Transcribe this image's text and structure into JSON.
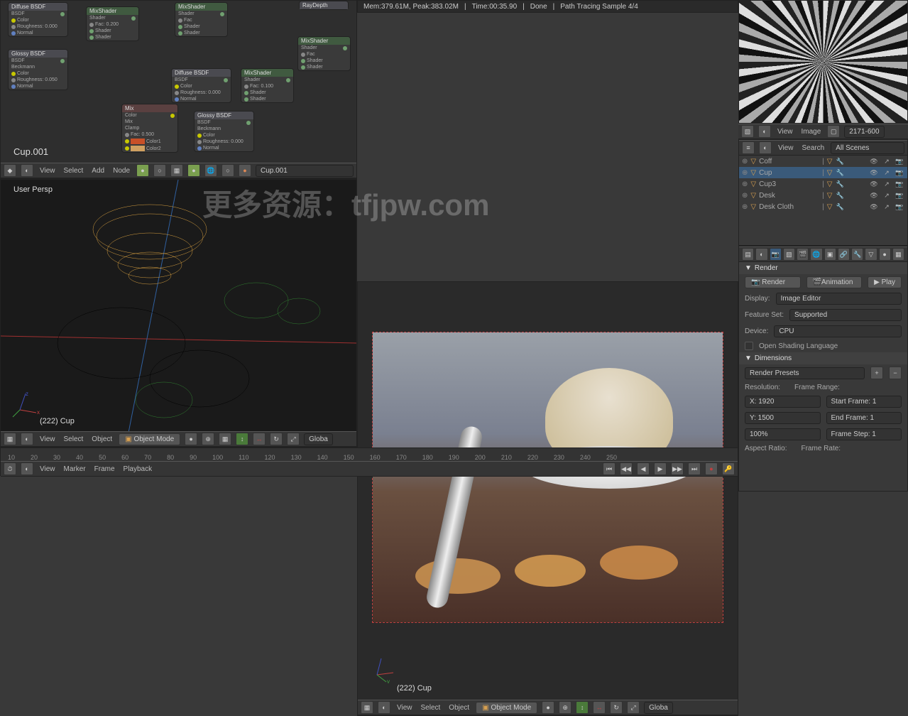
{
  "status_bar": {
    "mem": "Mem:379.61M, Peak:383.02M",
    "time": "Time:00:35.90",
    "done": "Done",
    "pathtrace": "Path Tracing Sample 4/4"
  },
  "node_editor": {
    "material": "Cup.001",
    "menu": {
      "view": "View",
      "select": "Select",
      "add": "Add",
      "node": "Node"
    },
    "nodes": {
      "diffuse1": {
        "title": "Diffuse BSDF",
        "rows": [
          "BSDF",
          "Color",
          "Roughness: 0.000",
          "Normal"
        ]
      },
      "glossy1": {
        "title": "Glossy BSDF",
        "rows": [
          "BSDF",
          "Beckmann",
          "Color",
          "Roughness: 0.050",
          "Normal"
        ]
      },
      "mix1": {
        "title": "Mix",
        "rows": [
          "Color",
          "Mix",
          "Clamp",
          "Fac: 0.500",
          "Color1",
          "Color2"
        ]
      },
      "mixshader1": {
        "title": "MixShader",
        "rows": [
          "Shader",
          "Fac: 0.200",
          "Shader",
          "Shader"
        ]
      },
      "diffuse2": {
        "title": "Diffuse BSDF",
        "rows": [
          "BSDF",
          "Color",
          "Roughness: 0.000",
          "Normal"
        ]
      },
      "glossy2": {
        "title": "Glossy BSDF",
        "rows": [
          "BSDF",
          "Beckmann",
          "Color",
          "Roughness: 0.000",
          "Normal"
        ]
      },
      "mixshader2": {
        "title": "MixShader",
        "rows": [
          "Shader",
          "Fac: 0.100",
          "Shader",
          "Shader"
        ]
      },
      "mixshader3": {
        "title": "MixShader",
        "rows": [
          "Shader",
          "Fac",
          "Shader",
          "Shader"
        ]
      },
      "raydepth": {
        "title": "RayDepth"
      }
    }
  },
  "viewport3d": {
    "label": "User Persp",
    "object": "(222) Cup",
    "menu": {
      "view": "View",
      "select": "Select",
      "object": "Object"
    },
    "mode": "Object Mode",
    "global": "Globa"
  },
  "render_view": {
    "object": "(222) Cup"
  },
  "image_editor": {
    "menu": {
      "view": "View",
      "image": "Image"
    },
    "name": "2171-600"
  },
  "outliner": {
    "menu": {
      "view": "View",
      "search": "Search"
    },
    "scenes": "All Scenes",
    "items": [
      {
        "name": "Coff"
      },
      {
        "name": "Cup"
      },
      {
        "name": "Cup3"
      },
      {
        "name": "Desk"
      },
      {
        "name": "Desk Cloth"
      }
    ]
  },
  "properties": {
    "render_hdr": "Render",
    "render_btn": "Render",
    "animation_btn": "Animation",
    "play_btn": "Play",
    "display": "Display:",
    "display_val": "Image Editor",
    "featureset": "Feature Set:",
    "featureset_val": "Supported",
    "device": "Device:",
    "device_val": "CPU",
    "osl": "Open Shading Language",
    "dimensions_hdr": "Dimensions",
    "presets": "Render Presets",
    "resolution": "Resolution:",
    "res_x": "X: 1920",
    "res_y": "Y: 1500",
    "res_pct": "100%",
    "aspect": "Aspect Ratio:",
    "frame_range": "Frame Range:",
    "start_frame": "Start Frame: 1",
    "end_frame": "End Frame: 1",
    "frame_step": "Frame Step: 1",
    "frame_rate": "Frame Rate:"
  },
  "timeline": {
    "menu": {
      "view": "View",
      "marker": "Marker",
      "frame": "Frame",
      "playback": "Playback"
    },
    "frames": [
      "10",
      "20",
      "30",
      "40",
      "50",
      "60",
      "70",
      "80",
      "90",
      "100",
      "110",
      "120",
      "130",
      "140",
      "150",
      "160",
      "170",
      "180",
      "190",
      "200",
      "210",
      "220",
      "230",
      "240",
      "250"
    ]
  },
  "watermark": "更多资源：tfjpw.com"
}
